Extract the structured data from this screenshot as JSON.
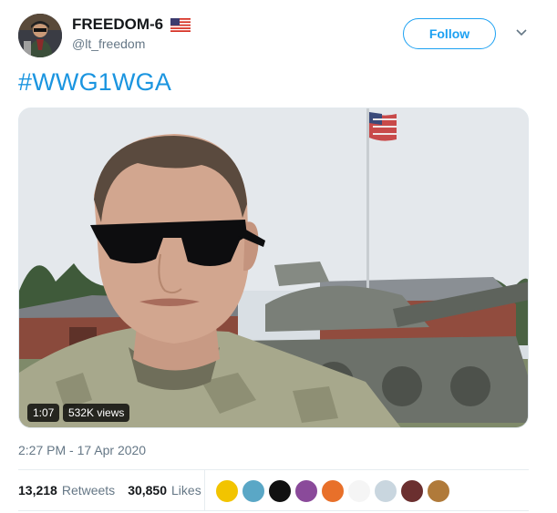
{
  "user": {
    "display_name": "FREEDOM-6",
    "handle": "@lt_freedom",
    "badge_icon": "us-flag-icon"
  },
  "follow_label": "Follow",
  "tweet_text": "#WWG1WGA",
  "media": {
    "duration": "1:07",
    "views": "532K views"
  },
  "timestamp": "2:27 PM - 17 Apr 2020",
  "stats": {
    "retweets_count": "13,218",
    "retweets_label": "Retweets",
    "likes_count": "30,850",
    "likes_label": "Likes"
  },
  "likers": [
    {
      "name": "liker-avatar-1",
      "color": "#f2c400"
    },
    {
      "name": "liker-avatar-2",
      "color": "#5aa7c6"
    },
    {
      "name": "liker-avatar-3",
      "color": "#111111"
    },
    {
      "name": "liker-avatar-4",
      "color": "#8a4a9a"
    },
    {
      "name": "liker-avatar-5",
      "color": "#e8702a"
    },
    {
      "name": "liker-avatar-6",
      "color": "#f5f5f5"
    },
    {
      "name": "liker-avatar-7",
      "color": "#c9d6df"
    },
    {
      "name": "liker-avatar-8",
      "color": "#6b2f2f"
    },
    {
      "name": "liker-avatar-9",
      "color": "#b07a3a"
    }
  ],
  "colors": {
    "accent": "#1da1f2",
    "hashtag": "#1b95e0",
    "secondary_text": "#657786"
  }
}
